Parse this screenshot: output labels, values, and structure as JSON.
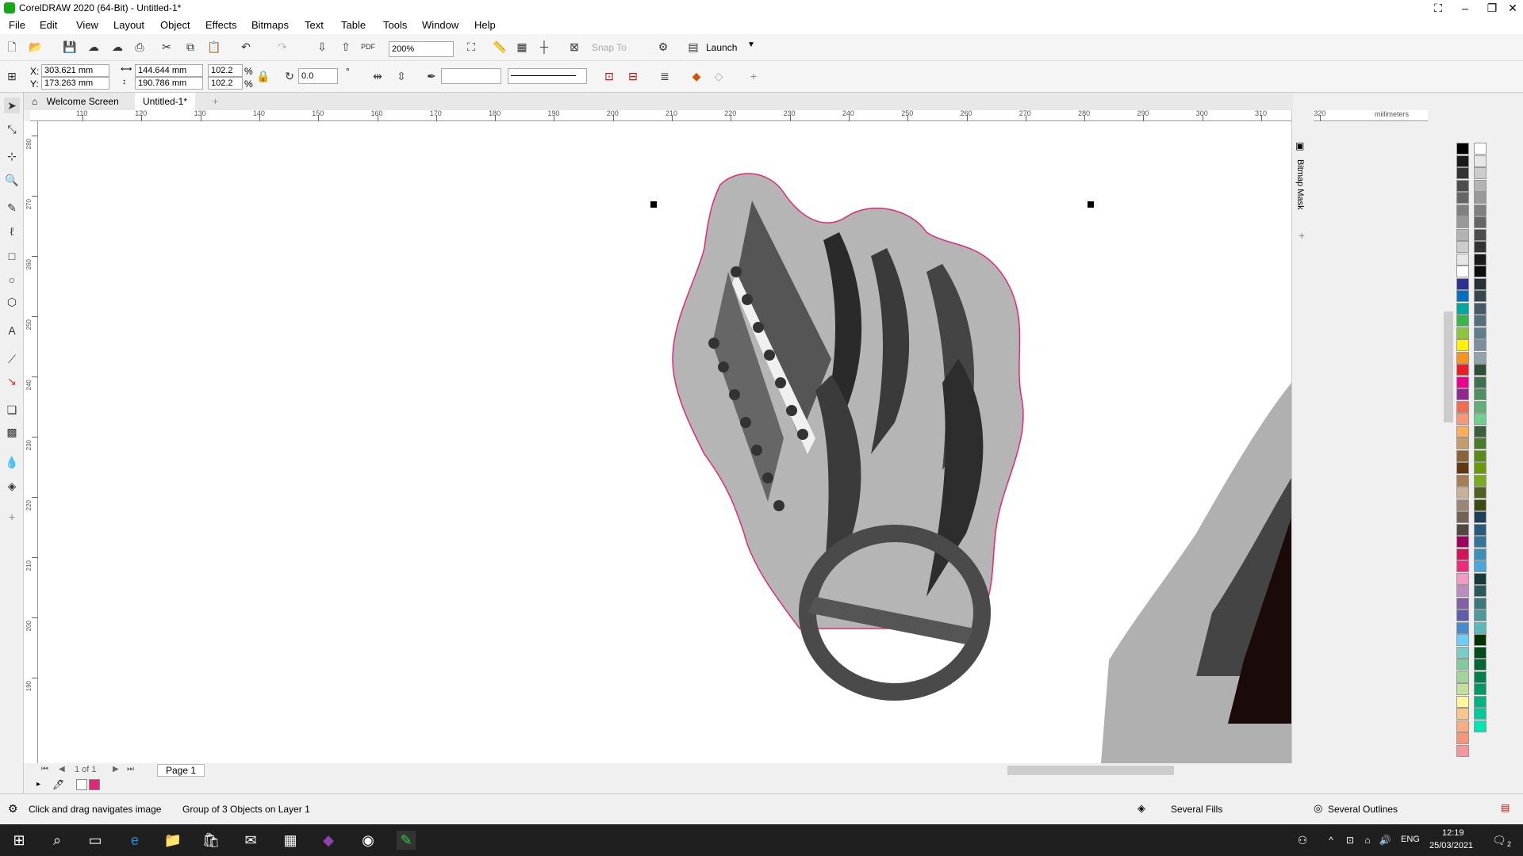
{
  "window": {
    "title": "CorelDRAW 2020 (64-Bit) - Untitled-1*"
  },
  "menu": [
    "File",
    "Edit",
    "View",
    "Layout",
    "Object",
    "Effects",
    "Bitmaps",
    "Text",
    "Table",
    "Tools",
    "Window",
    "Help"
  ],
  "toolbar": {
    "zoom": "200%",
    "snap_to": "Snap To",
    "launch": "Launch"
  },
  "property_bar": {
    "x_label": "X:",
    "x_value": "303.621 mm",
    "y_label": "Y:",
    "y_value": "173.263 mm",
    "width_value": "144.644 mm",
    "height_value": "190.786 mm",
    "scale_w": "102.2",
    "scale_h": "102.2",
    "percent_sign": "%",
    "rotation": "0.0",
    "degree_sign": "°"
  },
  "tabs": {
    "welcome": "Welcome Screen",
    "document": "Untitled-1*"
  },
  "ruler": {
    "units": "millimeters",
    "h_ticks": [
      "110",
      "120",
      "130",
      "140",
      "150",
      "160",
      "170",
      "180",
      "190",
      "200",
      "210",
      "220",
      "230",
      "240",
      "250",
      "260",
      "270",
      "280",
      "290",
      "300",
      "310",
      "320"
    ],
    "v_ticks": [
      "280",
      "270",
      "260",
      "250",
      "240",
      "230",
      "220",
      "210",
      "200",
      "190"
    ]
  },
  "docker": {
    "bitmap_mask": "Bitmap Mask"
  },
  "page_nav": {
    "page_count": "1 of 1",
    "page_tab": "Page 1"
  },
  "status": {
    "hint": "Click and drag navigates image",
    "selection": "Group of 3 Objects on Layer 1",
    "fill": "Several Fills",
    "outline": "Several Outlines"
  },
  "taskbar": {
    "lang": "ENG",
    "time": "12:19",
    "date": "25/03/2021",
    "notifications": "2"
  },
  "palette_colors": [
    "#000000",
    "#1a1a1a",
    "#333333",
    "#4d4d4d",
    "#666666",
    "#808080",
    "#999999",
    "#b3b3b3",
    "#cccccc",
    "#e6e6e6",
    "#ffffff",
    "#2e3192",
    "#0071bc",
    "#00a99d",
    "#39b54a",
    "#8cc63f",
    "#fff200",
    "#f7941d",
    "#ed1c24",
    "#ec008c",
    "#92278f",
    "#f26c4f",
    "#f7977a",
    "#fbaf5d",
    "#c69c6d",
    "#8c6239",
    "#603913",
    "#a67c52",
    "#c7b299",
    "#998675",
    "#736357",
    "#534741",
    "#9e005d",
    "#d4145a",
    "#ee2a7b",
    "#f49ac1",
    "#bd8cbf",
    "#8560a8",
    "#605ca8",
    "#448ccb",
    "#6dcff6",
    "#7accc8",
    "#82ca9c",
    "#a3d39c",
    "#c4df9b",
    "#fff799",
    "#fdc689",
    "#f9ad81",
    "#f69679",
    "#f5989d"
  ],
  "palette_colors2": [
    "#ffffff",
    "#e6e6e6",
    "#cccccc",
    "#b3b3b3",
    "#999999",
    "#808080",
    "#666666",
    "#4d4d4d",
    "#333333",
    "#1a1a1a",
    "#0d0d0d",
    "#263238",
    "#37474f",
    "#455a64",
    "#546e7a",
    "#607d8b",
    "#78909c",
    "#90a4ae",
    "#2e4f3a",
    "#3f6f4f",
    "#4f8f63",
    "#5faf77",
    "#6fcf8b",
    "#3a5f3a",
    "#4a7a2a",
    "#5a8a1a",
    "#6a9a0a",
    "#7aaa20",
    "#506020",
    "#3a4a10",
    "#20405a",
    "#2a5a7a",
    "#34749a",
    "#3e8eba",
    "#48a8da",
    "#1a3a3a",
    "#2a5a5a",
    "#3a7a7a",
    "#4a9a9a",
    "#5ababa",
    "#003300",
    "#004d1a",
    "#006633",
    "#00804d",
    "#009966",
    "#00b380",
    "#00cc99",
    "#00e6b3"
  ]
}
